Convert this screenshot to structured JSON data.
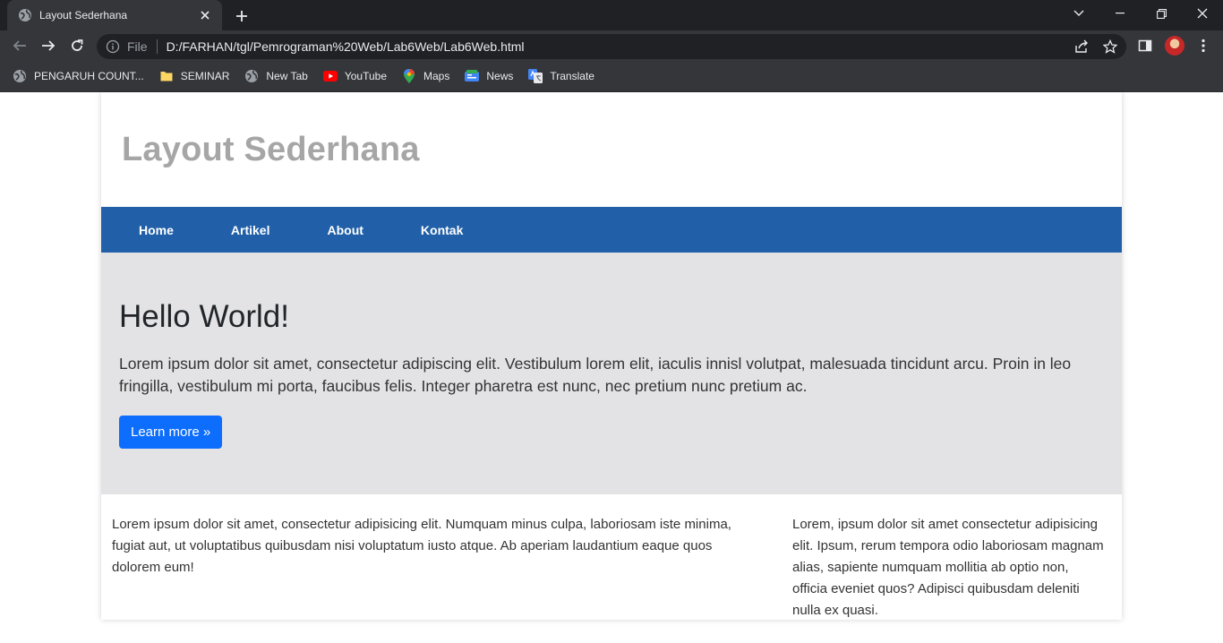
{
  "browser": {
    "tab_title": "Layout Sederhana",
    "omnibox_scheme": "File",
    "url": "D:/FARHAN/tgl/Pemrograman%20Web/Lab6Web/Lab6Web.html",
    "bookmarks": [
      {
        "label": "PENGARUH COUNT...",
        "icon": "globe-icon"
      },
      {
        "label": "SEMINAR",
        "icon": "folder-icon"
      },
      {
        "label": "New Tab",
        "icon": "globe-icon"
      },
      {
        "label": "YouTube",
        "icon": "youtube-icon"
      },
      {
        "label": "Maps",
        "icon": "maps-icon"
      },
      {
        "label": "News",
        "icon": "news-icon"
      },
      {
        "label": "Translate",
        "icon": "translate-icon"
      }
    ]
  },
  "page": {
    "site_title": "Layout Sederhana",
    "nav": [
      "Home",
      "Artikel",
      "About",
      "Kontak"
    ],
    "hero": {
      "heading": "Hello World!",
      "text": "Lorem ipsum dolor sit amet, consectetur adipiscing elit. Vestibulum lorem elit, iaculis innisl volutpat, malesuada tincidunt arcu. Proin in leo fringilla, vestibulum mi porta, faucibus felis. Integer pharetra est nunc, nec pretium nunc pretium ac.",
      "button": "Learn more »"
    },
    "main_text": "Lorem ipsum dolor sit amet, consectetur adipisicing elit. Numquam minus culpa, laboriosam iste minima, fugiat aut, ut voluptatibus quibusdam nisi voluptatum iusto atque. Ab aperiam laudantium eaque quos dolorem eum!",
    "side_text": "Lorem, ipsum dolor sit amet consectetur adipisicing elit. Ipsum, rerum tempora odio laboriosam magnam alias, sapiente numquam mollitia ab optio non, officia eveniet quos? Adipisci quibusdam deleniti nulla ex quasi."
  },
  "colors": {
    "navbar": "#2160a8",
    "hero_bg": "#e3e3e5",
    "button": "#0d6efd",
    "site_title": "#a6a6a6"
  }
}
